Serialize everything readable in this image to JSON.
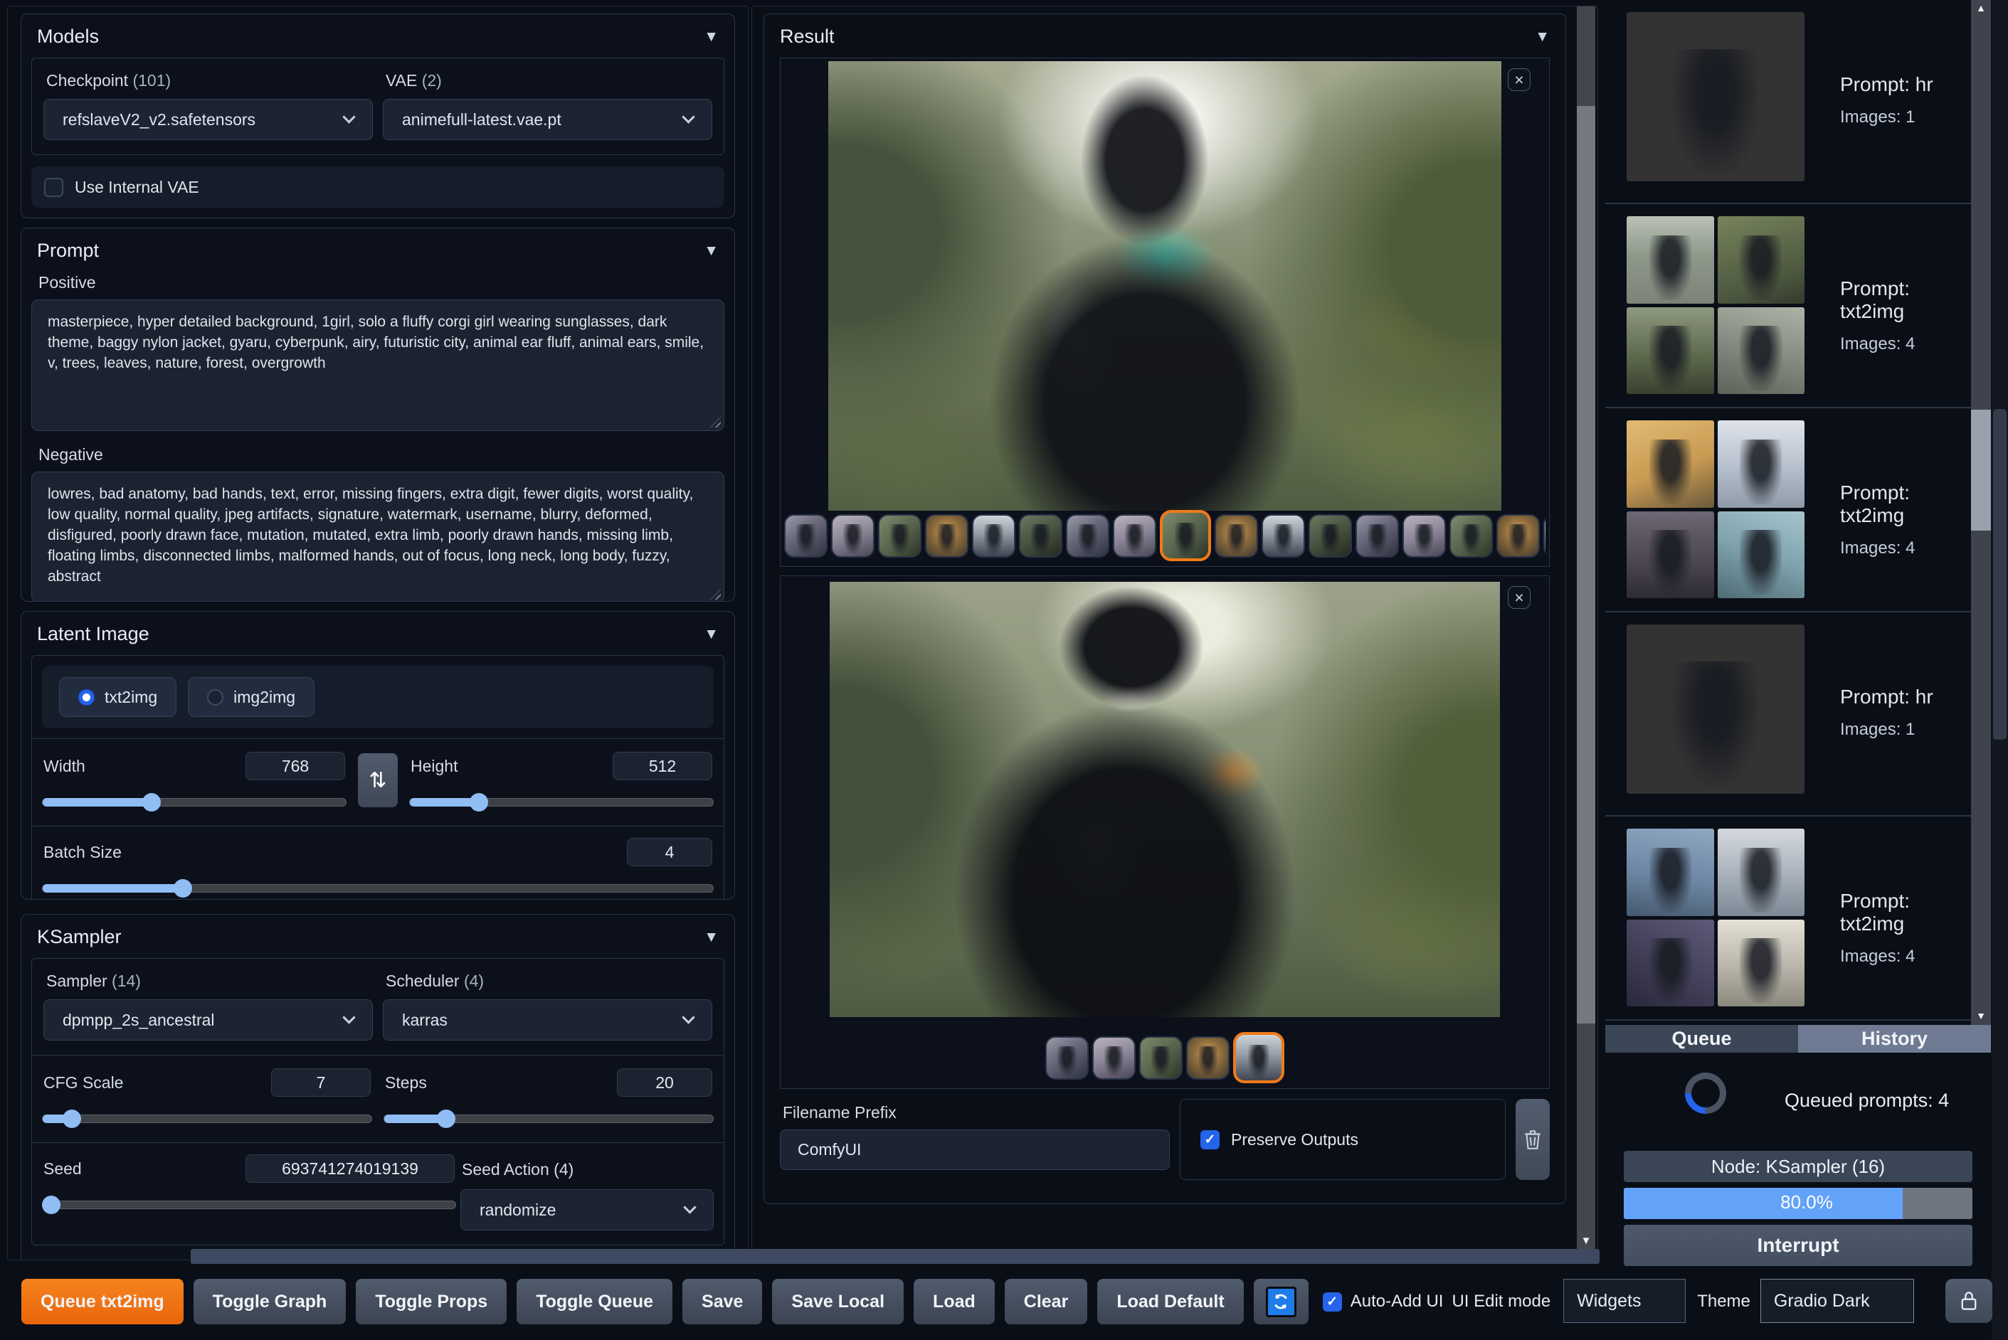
{
  "icons": {
    "collapse": "▼",
    "close": "×",
    "swap": "⇅",
    "scroll_up": "▲",
    "scroll_down": "▼",
    "check": "✓"
  },
  "colors": {
    "accent_orange": "#f07a18",
    "slider_blue": "#8fbdf4",
    "progress_blue": "#62a2f8",
    "checkbox_blue": "#2563eb"
  },
  "left_panel": {
    "models": {
      "title": "Models",
      "checkpoint_label": "Checkpoint",
      "checkpoint_count": "(101)",
      "checkpoint_value": "refslaveV2_v2.safetensors",
      "vae_label": "VAE",
      "vae_count": "(2)",
      "vae_value": "animefull-latest.vae.pt",
      "use_internal_vae_label": "Use Internal VAE",
      "use_internal_vae_checked": false
    },
    "prompt": {
      "title": "Prompt",
      "positive_label": "Positive",
      "positive_value": "masterpiece, hyper detailed background, 1girl, solo a fluffy corgi girl wearing sunglasses, dark theme, baggy nylon jacket, gyaru, cyberpunk, airy, futuristic city, animal ear fluff, animal ears, smile, v, trees, leaves, nature, forest, overgrowth",
      "negative_label": "Negative",
      "negative_value": "lowres, bad anatomy, bad hands, text, error, missing fingers, extra digit, fewer digits, worst quality, low quality, normal quality, jpeg artifacts, signature, watermark, username, blurry, deformed, disfigured, poorly drawn face, mutation, mutated, extra limb, poorly drawn hands, missing limb, floating limbs, disconnected limbs, malformed hands, out of focus, long neck, long body, fuzzy, abstract"
    },
    "latent": {
      "title": "Latent Image",
      "mode_txt2img": "txt2img",
      "mode_img2img": "img2img",
      "selected_mode": "txt2img",
      "width_label": "Width",
      "width_value": "768",
      "width_percent": 36,
      "height_label": "Height",
      "height_value": "512",
      "height_percent": 23,
      "batch_label": "Batch Size",
      "batch_value": "4",
      "batch_percent": 21
    },
    "ksampler": {
      "title": "KSampler",
      "sampler_label": "Sampler",
      "sampler_count": "(14)",
      "sampler_value": "dpmpp_2s_ancestral",
      "scheduler_label": "Scheduler",
      "scheduler_count": "(4)",
      "scheduler_value": "karras",
      "cfg_label": "CFG Scale",
      "cfg_value": "7",
      "cfg_percent": 9,
      "steps_label": "Steps",
      "steps_value": "20",
      "steps_percent": 19,
      "seed_label": "Seed",
      "seed_value": "693741274019139",
      "seed_percent": 0,
      "seed_action_label": "Seed Action",
      "seed_action_count": "(4)",
      "seed_action_value": "randomize"
    }
  },
  "result_panel": {
    "title": "Result",
    "viewer1": {
      "thumbnail_count": 17,
      "selected_index": 8
    },
    "viewer2": {
      "thumbnail_count": 5,
      "selected_index": 4
    },
    "filename_prefix_label": "Filename Prefix",
    "filename_prefix_value": "ComfyUI",
    "preserve_outputs_label": "Preserve Outputs",
    "preserve_outputs_checked": true
  },
  "sidebar": {
    "history_items": [
      {
        "prompt": "Prompt: hr",
        "images": "Images: 1",
        "grid": false
      },
      {
        "prompt": "Prompt: txt2img",
        "images": "Images: 4",
        "grid": true
      },
      {
        "prompt": "Prompt: txt2img",
        "images": "Images: 4",
        "grid": true
      },
      {
        "prompt": "Prompt: hr",
        "images": "Images: 1",
        "grid": false
      },
      {
        "prompt": "Prompt: txt2img",
        "images": "Images: 4",
        "grid": true
      }
    ],
    "tabs": [
      {
        "label": "Queue",
        "active": false
      },
      {
        "label": "History",
        "active": true
      }
    ],
    "queued_prompts_text": "Queued prompts: 4",
    "node_text": "Node: KSampler (16)",
    "progress_label": "80.0%",
    "progress_percent": 80,
    "interrupt_label": "Interrupt"
  },
  "toolbar": {
    "buttons": [
      {
        "label": "Queue txt2img",
        "name": "queue-txt2img-button",
        "primary": true
      },
      {
        "label": "Toggle Graph",
        "name": "toggle-graph-button"
      },
      {
        "label": "Toggle Props",
        "name": "toggle-props-button"
      },
      {
        "label": "Toggle Queue",
        "name": "toggle-queue-button"
      },
      {
        "label": "Save",
        "name": "save-button"
      },
      {
        "label": "Save Local",
        "name": "save-local-button"
      },
      {
        "label": "Load",
        "name": "load-button"
      },
      {
        "label": "Clear",
        "name": "clear-button"
      },
      {
        "label": "Load Default",
        "name": "load-default-button"
      }
    ],
    "auto_add_ui_label": "Auto-Add UI",
    "auto_add_ui_checked": true,
    "ui_edit_mode_label": "UI Edit mode",
    "widgets_value": "Widgets",
    "theme_label": "Theme",
    "theme_value": "Gradio Dark"
  }
}
